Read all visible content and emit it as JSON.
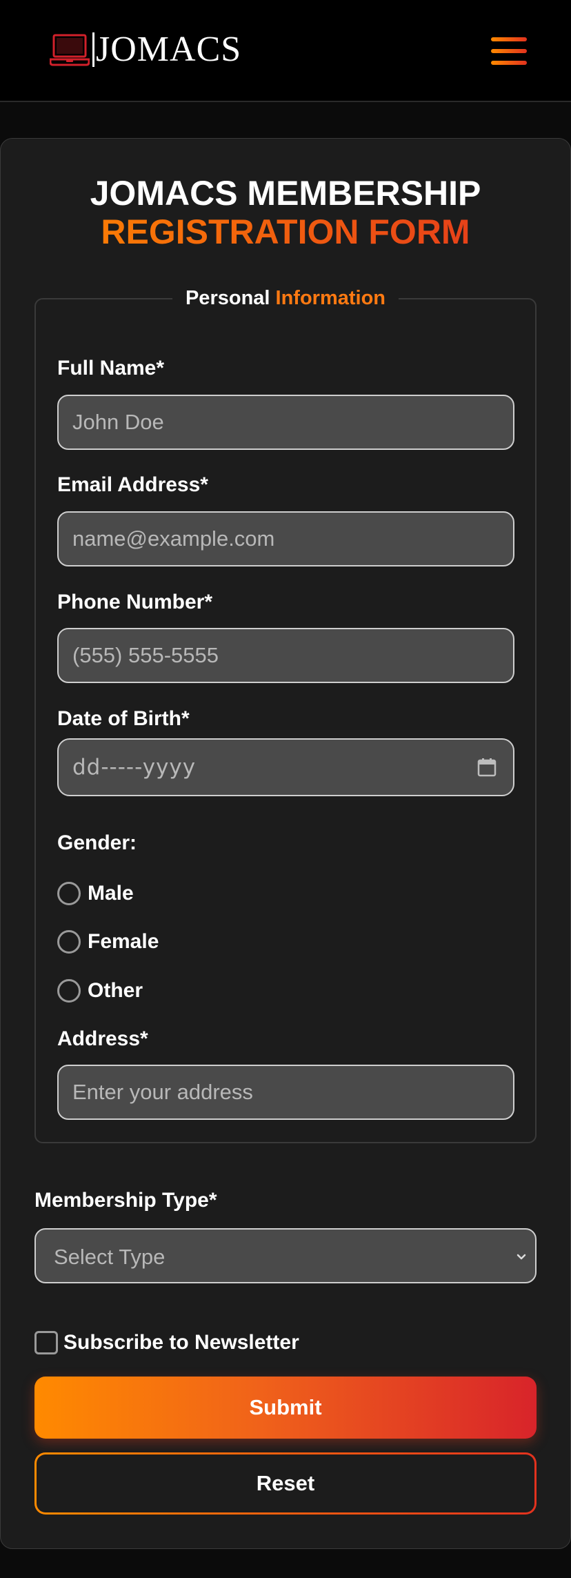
{
  "brand": {
    "logo_icon": "laptop-icon",
    "name": "JOMACS",
    "accent_start": "#ff8a00",
    "accent_end": "#e2321e"
  },
  "nav": {
    "menu_icon": "hamburger-menu-icon"
  },
  "form": {
    "title_line1": "JOMACS MEMBERSHIP",
    "title_line2": "REGISTRATION FORM",
    "section_title_part1": "Personal",
    "section_title_part2": "Information",
    "fields": {
      "full_name": {
        "label": "Full Name*",
        "placeholder": "John Doe"
      },
      "email": {
        "label": "Email Address*",
        "placeholder": "name@example.com"
      },
      "phone": {
        "label": "Phone Number*",
        "placeholder": "(555) 555-5555"
      },
      "dob": {
        "label": "Date of Birth*",
        "placeholder": "dd-----yyyy",
        "icon": "calendar-icon"
      },
      "address": {
        "label": "Address*",
        "placeholder": "Enter your address"
      }
    },
    "gender": {
      "label": "Gender:",
      "options": [
        "Male",
        "Female",
        "Other"
      ]
    },
    "membership": {
      "label": "Membership Type*",
      "selected": "Select Type",
      "icon": "chevron-down-icon"
    },
    "newsletter_label": "Subscribe to Newsletter",
    "submit_label": "Submit",
    "reset_label": "Reset"
  }
}
